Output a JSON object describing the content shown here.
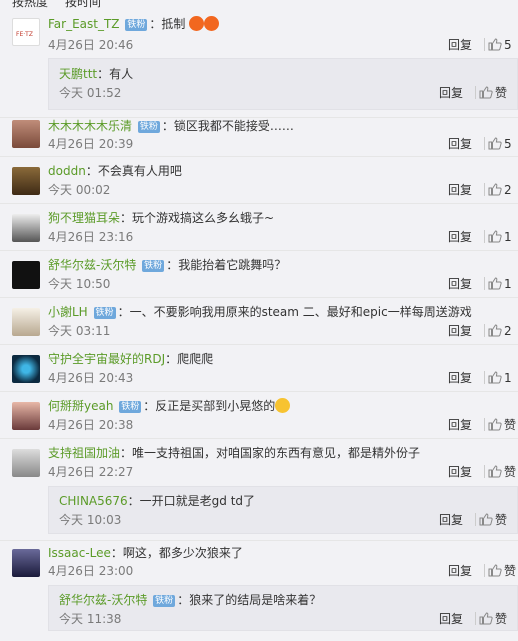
{
  "sort_tabs": [
    "按热度",
    "按时间"
  ],
  "reply_label": "回复",
  "like_label": "赞",
  "badge_label": "铁粉",
  "comments": [
    {
      "user": "Far_East_TZ",
      "badge": true,
      "text": "抵制",
      "time": "4月26日 20:46",
      "likes": "5",
      "emoji": 2,
      "sub": {
        "user": "天鹏ttt",
        "text": "：有人",
        "time": "今天 01:52",
        "likes": "赞"
      }
    },
    {
      "user": "木木木木木乐清",
      "badge": true,
      "text": "：锁区我都不能接受……",
      "time": "4月26日 20:39",
      "likes": "5"
    },
    {
      "user": "doddn",
      "badge": false,
      "text": "：不会真有人用吧",
      "time": "今天 00:02",
      "likes": "2"
    },
    {
      "user": "狗不理猫耳朵",
      "badge": false,
      "text": "：玩个游戏搞这么多幺蛾子~",
      "time": "4月26日 23:16",
      "likes": "1"
    },
    {
      "user": "舒华尔兹-沃尔特",
      "badge": true,
      "text": "：我能抬着它跳舞吗？",
      "time": "今天 10:50",
      "likes": "1"
    },
    {
      "user": "小謝LH",
      "badge": true,
      "text": "：一、不要影响我用原来的steam 二、最好和epic一样每周送游戏",
      "time": "今天 03:11",
      "likes": "2"
    },
    {
      "user": "守护全宇宙最好的RDJ",
      "badge": false,
      "text": "：爬爬爬",
      "time": "4月26日 20:43",
      "likes": "1"
    },
    {
      "user": "何掰掰yeah",
      "badge": true,
      "text": "：反正是买部到小晃悠的",
      "time": "4月26日 20:38",
      "likes": "赞",
      "emoji": 1
    },
    {
      "user": "支持祖国加油",
      "badge": false,
      "text": "：唯一支持祖国，对咱国家的东西有意见，都是精外份子",
      "time": "4月26日 22:27",
      "likes": "赞",
      "sub": {
        "user": "CHINA5676",
        "text": "：一开口就是老gd td了",
        "time": "今天 10:03",
        "likes": "赞"
      }
    },
    {
      "user": "Issaac-Lee",
      "badge": false,
      "text": "：啊这，都多少次狼来了",
      "time": "4月26日 23:00",
      "likes": "赞",
      "sub": {
        "user": "舒华尔兹-沃尔特",
        "badge": true,
        "text": "：狼来了的结局是啥来着？",
        "time": "今天 11:38",
        "likes": "赞"
      }
    }
  ]
}
